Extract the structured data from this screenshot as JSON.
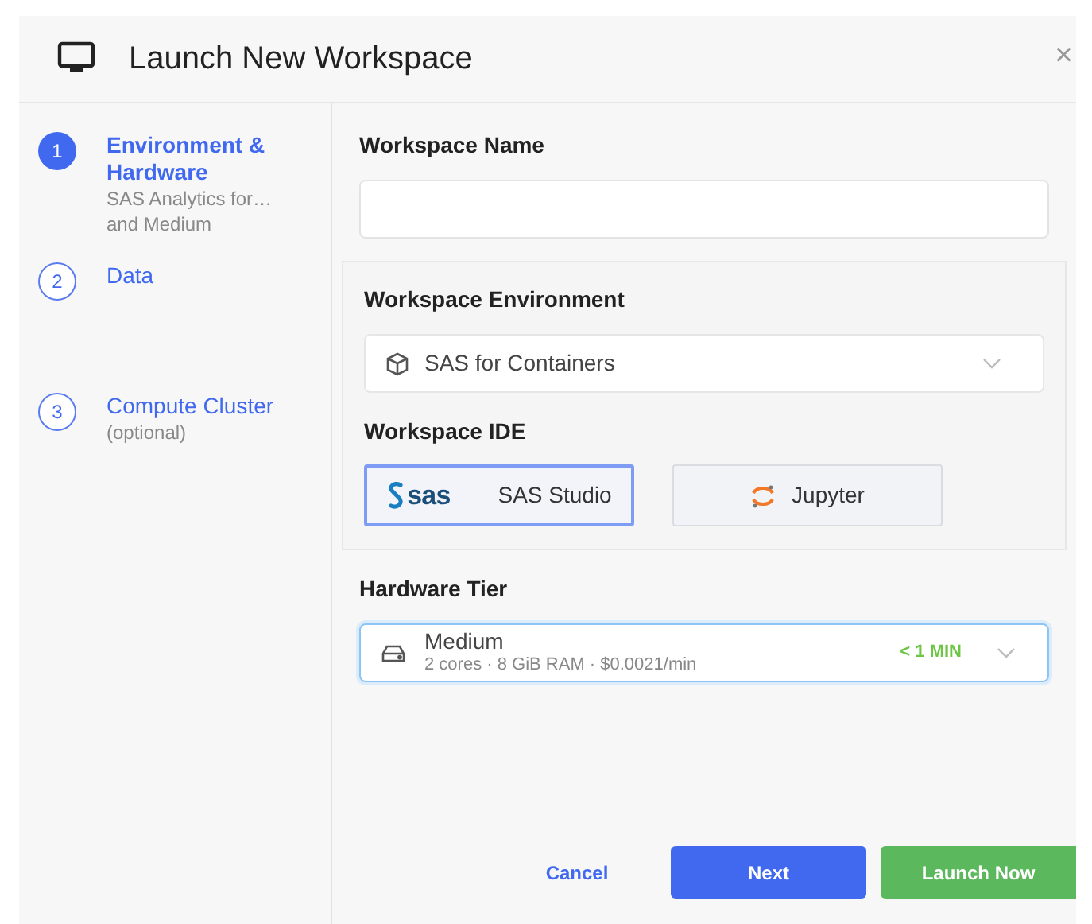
{
  "window": {
    "title": "Launch New Workspace",
    "close": "×"
  },
  "steps": [
    {
      "number": "1",
      "label": "Environment &",
      "label_2": "Hardware",
      "subtitle": [
        "SAS Analytics for…",
        "and Medium"
      ],
      "selected": true
    },
    {
      "number": "2",
      "label": "Data",
      "selected": false
    },
    {
      "number": "3",
      "label": "Compute Cluster",
      "subtitle": [
        "(optional)"
      ],
      "selected": false
    }
  ],
  "name_field": {
    "label": "Workspace Name"
  },
  "environment": {
    "label": "Workspace Environment",
    "value": "SAS for Containers"
  },
  "ide": {
    "label": "Workspace IDE",
    "options": [
      {
        "kind": "sas",
        "logo": "sas",
        "label": "SAS Studio",
        "selected": true
      },
      {
        "kind": "jupyter",
        "label": "Jupyter",
        "selected": false
      }
    ]
  },
  "hardware": {
    "label": "Hardware Tier",
    "value": "Medium",
    "detail": "2 cores · 8 GiB RAM · $0.0021/min",
    "time": "< 1 MIN"
  },
  "buttons": [
    {
      "kind": "link",
      "label": "Cancel"
    },
    {
      "kind": "primary",
      "label": "Next"
    },
    {
      "kind": "success",
      "label": "Launch Now"
    }
  ]
}
